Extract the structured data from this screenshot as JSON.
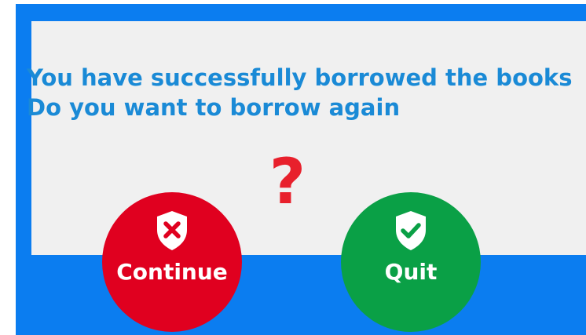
{
  "dialog": {
    "message_line1": "You have successfully borrowed the books",
    "message_line2": "Do you want to borrow again",
    "question_mark": "?"
  },
  "buttons": {
    "continue": {
      "label": "Continue",
      "icon": "shield-x-icon",
      "color": "#e0001f"
    },
    "quit": {
      "label": "Quit",
      "icon": "shield-check-icon",
      "color": "#0aa046"
    }
  },
  "colors": {
    "background": "#0b7df0",
    "panel": "#f0f0f0",
    "message_text": "#1a8ad6",
    "question_mark": "#e8202c"
  }
}
